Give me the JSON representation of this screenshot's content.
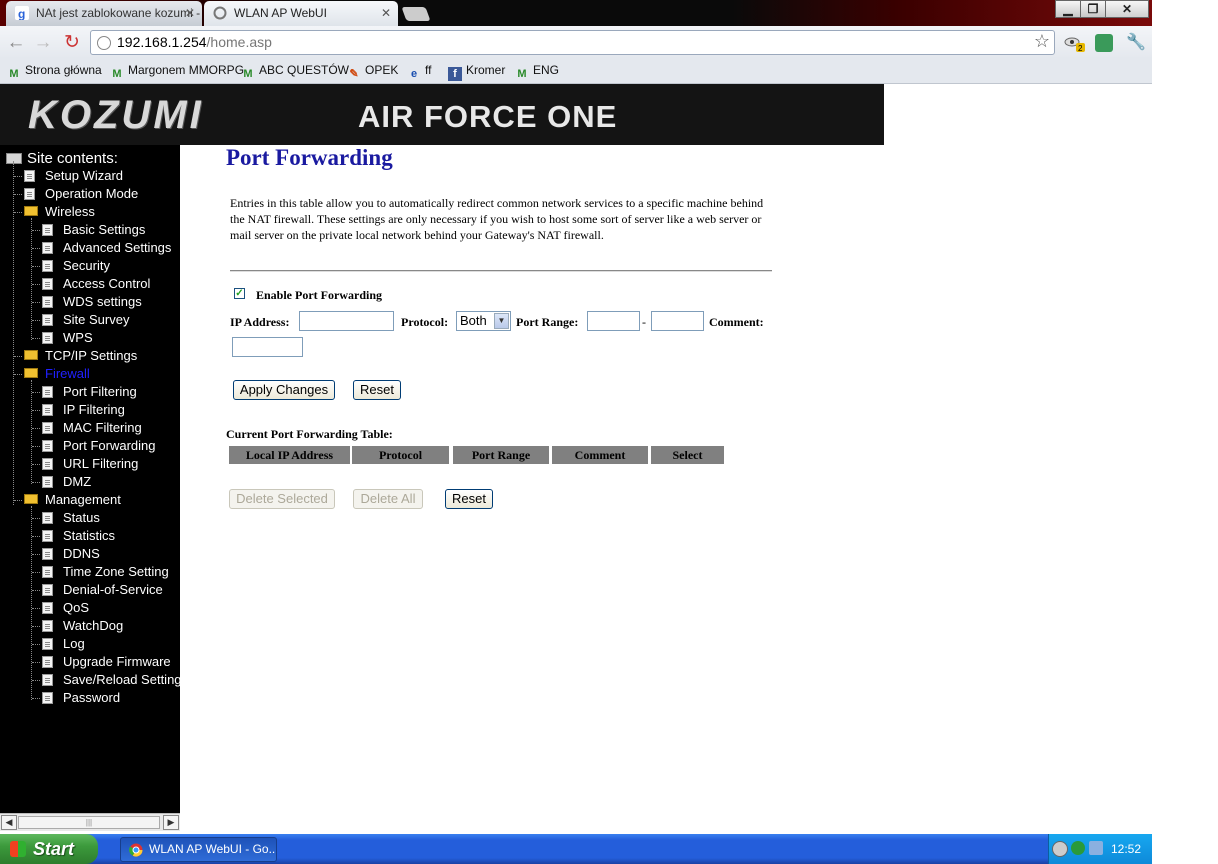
{
  "browser": {
    "tabs": [
      {
        "label": "NAt jest zablokowane kozumi - ",
        "active": false
      },
      {
        "label": "WLAN AP WebUI",
        "active": true
      }
    ],
    "url_host": "192.168.1.254",
    "url_path": "/home.asp",
    "bookmarks": [
      {
        "label": "Strona główna",
        "icon": "margonem-icon"
      },
      {
        "label": "Margonem MMORPG",
        "icon": "margonem-icon"
      },
      {
        "label": "ABC QUESTÓW",
        "icon": "margonem-icon"
      },
      {
        "label": "OPEK",
        "icon": "opek-icon"
      },
      {
        "label": "ff",
        "icon": "ie-icon"
      },
      {
        "label": "Kromer",
        "icon": "facebook-icon"
      },
      {
        "label": "ENG",
        "icon": "margonem-icon"
      }
    ],
    "window_buttons": {
      "minimize": "▁",
      "maximize": "❐",
      "close": "✕"
    },
    "extensions": {
      "badge": "2"
    }
  },
  "banner": {
    "logo": "KOZUMI",
    "title": "AIR FORCE ONE"
  },
  "sidebar": {
    "root": "Site contents:",
    "items": [
      {
        "label": "Setup Wizard",
        "level": 1,
        "type": "doc"
      },
      {
        "label": "Operation Mode",
        "level": 1,
        "type": "doc"
      },
      {
        "label": "Wireless",
        "level": 1,
        "type": "folder-open"
      },
      {
        "label": "Basic Settings",
        "level": 2,
        "type": "doc"
      },
      {
        "label": "Advanced Settings",
        "level": 2,
        "type": "doc"
      },
      {
        "label": "Security",
        "level": 2,
        "type": "doc"
      },
      {
        "label": "Access Control",
        "level": 2,
        "type": "doc"
      },
      {
        "label": "WDS settings",
        "level": 2,
        "type": "doc"
      },
      {
        "label": "Site Survey",
        "level": 2,
        "type": "doc"
      },
      {
        "label": "WPS",
        "level": 2,
        "type": "doc"
      },
      {
        "label": "TCP/IP Settings",
        "level": 1,
        "type": "folder"
      },
      {
        "label": "Firewall",
        "level": 1,
        "type": "folder-open",
        "active": true
      },
      {
        "label": "Port Filtering",
        "level": 2,
        "type": "doc"
      },
      {
        "label": "IP Filtering",
        "level": 2,
        "type": "doc"
      },
      {
        "label": "MAC Filtering",
        "level": 2,
        "type": "doc"
      },
      {
        "label": "Port Forwarding",
        "level": 2,
        "type": "doc"
      },
      {
        "label": "URL Filtering",
        "level": 2,
        "type": "doc"
      },
      {
        "label": "DMZ",
        "level": 2,
        "type": "doc"
      },
      {
        "label": "Management",
        "level": 1,
        "type": "folder-open"
      },
      {
        "label": "Status",
        "level": 2,
        "type": "doc"
      },
      {
        "label": "Statistics",
        "level": 2,
        "type": "doc"
      },
      {
        "label": "DDNS",
        "level": 2,
        "type": "doc"
      },
      {
        "label": "Time Zone Setting",
        "level": 2,
        "type": "doc"
      },
      {
        "label": "Denial-of-Service",
        "level": 2,
        "type": "doc"
      },
      {
        "label": "QoS",
        "level": 2,
        "type": "doc"
      },
      {
        "label": "WatchDog",
        "level": 2,
        "type": "doc"
      },
      {
        "label": "Log",
        "level": 2,
        "type": "doc"
      },
      {
        "label": "Upgrade Firmware",
        "level": 2,
        "type": "doc"
      },
      {
        "label": "Save/Reload Setting",
        "level": 2,
        "type": "doc"
      },
      {
        "label": "Password",
        "level": 2,
        "type": "doc"
      }
    ]
  },
  "main": {
    "title": "Port Forwarding",
    "description": "Entries in this table allow you to automatically redirect common network services to a specific machine behind the NAT firewall. These settings are only necessary if you wish to host some sort of server like a web server or mail server on the private local network behind your Gateway's NAT firewall.",
    "enable_label": "Enable Port Forwarding",
    "enable_checked": true,
    "ip_label": "IP Address:",
    "ip_value": "",
    "protocol_label": "Protocol:",
    "protocol_value": "Both",
    "port_range_label": "Port Range:",
    "port_from": "",
    "port_dash": "-",
    "port_to": "",
    "comment_label": "Comment:",
    "comment_value": "",
    "apply_button": "Apply Changes",
    "reset_button": "Reset",
    "table_caption": "Current Port Forwarding Table:",
    "table_headers": [
      "Local IP Address",
      "Protocol",
      "Port Range",
      "Comment",
      "Select"
    ],
    "delete_selected": "Delete Selected",
    "delete_all": "Delete All",
    "reset_button2": "Reset"
  },
  "taskbar": {
    "start": "Start",
    "app": "WLAN AP WebUI - Go...",
    "clock": "12:52"
  },
  "colors": {
    "title_blue": "#1a1aa0",
    "active_link": "#2020ff",
    "table_header": "#808080"
  }
}
